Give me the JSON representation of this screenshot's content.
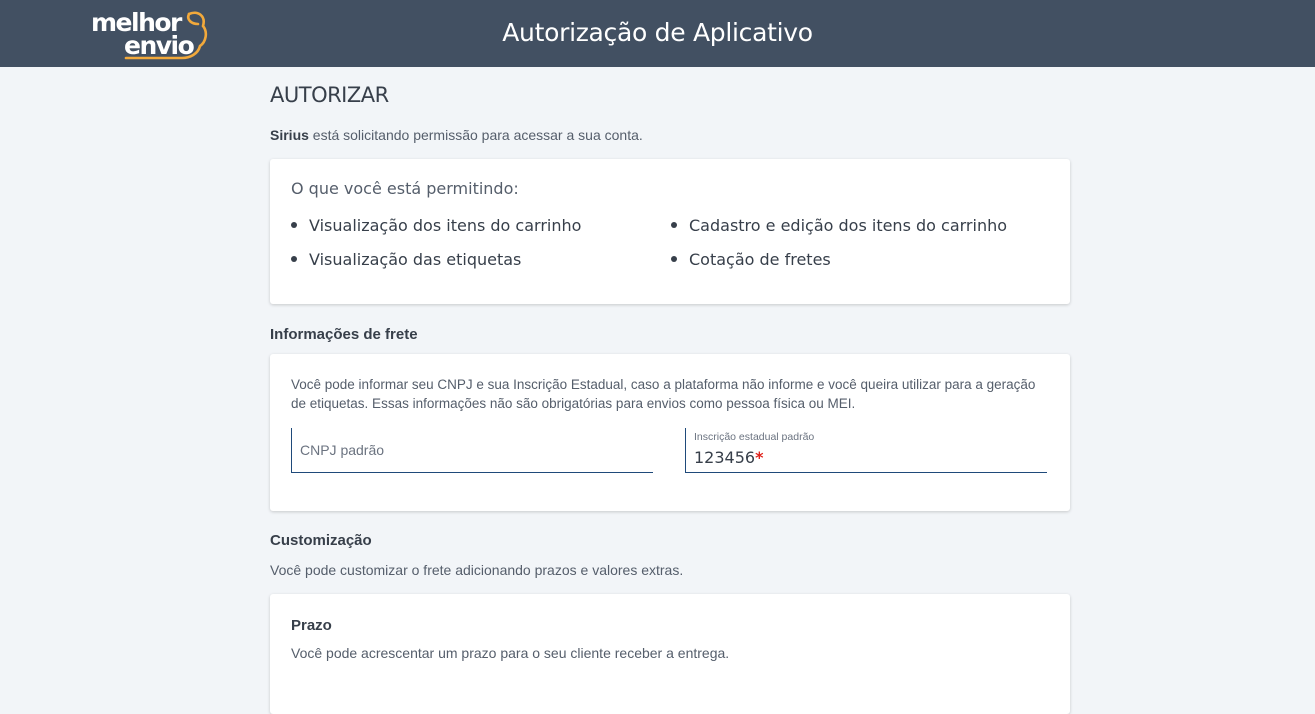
{
  "header": {
    "logo_line1": "melhor",
    "logo_line2": "envio",
    "title": "Autorização de Aplicativo"
  },
  "authorize": {
    "heading": "AUTORIZAR",
    "app_name": "Sirius",
    "request_text": " está solicitando permissão para acessar a sua conta."
  },
  "permissions": {
    "title": "O que você está permitindo:",
    "items": [
      "Visualização dos itens do carrinho",
      "Cadastro e edição dos itens do carrinho",
      "Visualização das etiquetas",
      "Cotação de fretes"
    ]
  },
  "shipping_info": {
    "title": "Informações de frete",
    "description": "Você pode informar seu CNPJ e sua Inscrição Estadual, caso a plataforma não informe e você queira utilizar para a geração de etiquetas. Essas informações não são obrigatórias para envios como pessoa física ou MEI.",
    "cnpj_placeholder": "CNPJ padrão",
    "cnpj_value": "",
    "ie_label": "Inscrição estadual padrão",
    "ie_value": "123456",
    "required_mark": "*"
  },
  "customization": {
    "title": "Customização",
    "description": "Você pode customizar o frete adicionando prazos e valores extras.",
    "prazo_title": "Prazo",
    "prazo_description": "Você pode acrescentar um prazo para o seu cliente receber a entrega."
  },
  "colors": {
    "header_bg": "#425062",
    "page_bg": "#f2f5f8",
    "logo_accent": "#f2a93b",
    "field_border": "#1f4a7a",
    "required": "#e0211a"
  }
}
